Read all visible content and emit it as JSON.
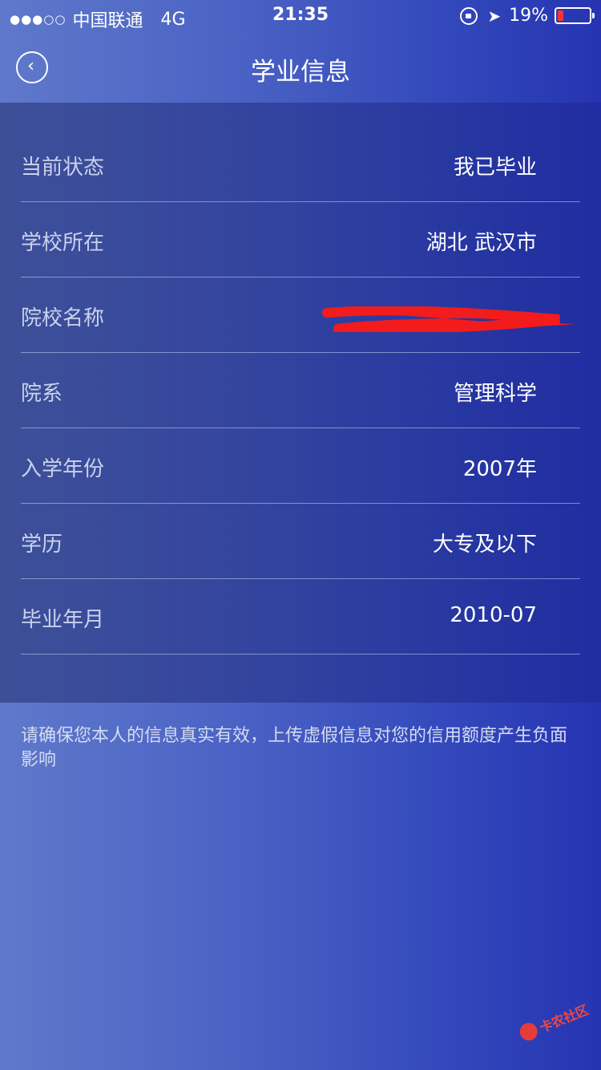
{
  "status_bar": {
    "signal": "●●●○○",
    "carrier": "中国联通",
    "network": "4G",
    "time": "21:35",
    "battery_percent": "19%",
    "battery_level": 0.19,
    "battery_color": "#ff3333"
  },
  "nav": {
    "title": "学业信息",
    "back_icon": "‹"
  },
  "rows": [
    {
      "label": "当前状态",
      "value": "我已毕业"
    },
    {
      "label": "学校所在",
      "value": "湖北 武汉市"
    },
    {
      "label": "院校名称",
      "value": ""
    },
    {
      "label": "院系",
      "value": "管理科学"
    },
    {
      "label": "入学年份",
      "value": "2007年"
    },
    {
      "label": "学历",
      "value": "大专及以下"
    },
    {
      "label": "毕业年月",
      "value": "2010-07"
    }
  ],
  "disclaimer": "请确保您本人的信息真实有效，上传虚假信息对您的信用额度产生负面影响",
  "watermark": {
    "text": "卡农社区",
    "icon": "logo-icon",
    "color": "#e84a4a"
  },
  "redaction_color": "#f21c1c"
}
